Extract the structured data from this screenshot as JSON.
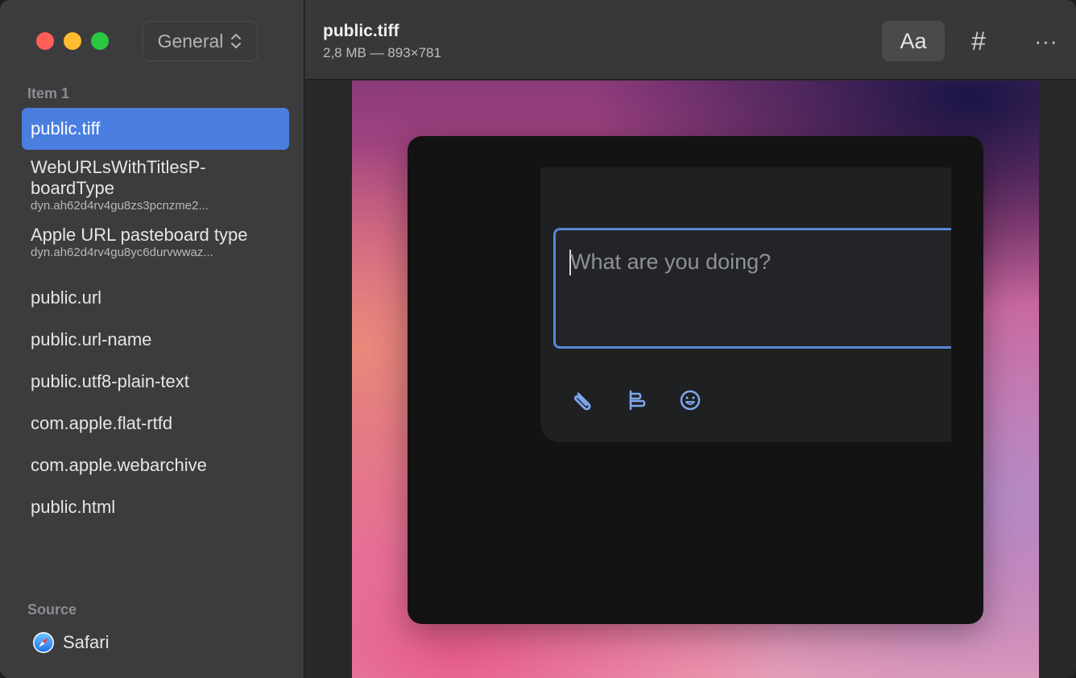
{
  "sidebar": {
    "selector_label": "General",
    "section_items_label": "Item 1",
    "items": [
      {
        "name": "public.tiff",
        "sub": ""
      },
      {
        "name": "WebURLsWithTitlesP-\nboardType",
        "sub": "dyn.ah62d4rv4gu8zs3pcnzme2..."
      },
      {
        "name": "Apple URL pasteboard type",
        "sub": "dyn.ah62d4rv4gu8yc6durvwwaz..."
      },
      {
        "name": "public.url",
        "sub": ""
      },
      {
        "name": "public.url-name",
        "sub": ""
      },
      {
        "name": "public.utf8-plain-text",
        "sub": ""
      },
      {
        "name": "com.apple.flat-rtfd",
        "sub": ""
      },
      {
        "name": "com.apple.webarchive",
        "sub": ""
      },
      {
        "name": "public.html",
        "sub": ""
      }
    ],
    "section_source_label": "Source",
    "source_app": "Safari"
  },
  "toolbar": {
    "title": "public.tiff",
    "meta": "2,8 MB — 893×781",
    "font_button": "Aa",
    "hash_button": "#",
    "more_button": "···"
  },
  "preview": {
    "placeholder": "What are you doing?",
    "icons": [
      "paperclip-icon",
      "align-icon",
      "emoji-icon"
    ]
  },
  "colors": {
    "accent": "#4a7fe0",
    "focus_border": "#5a86d6",
    "icon_blue": "#7ea6ee"
  }
}
